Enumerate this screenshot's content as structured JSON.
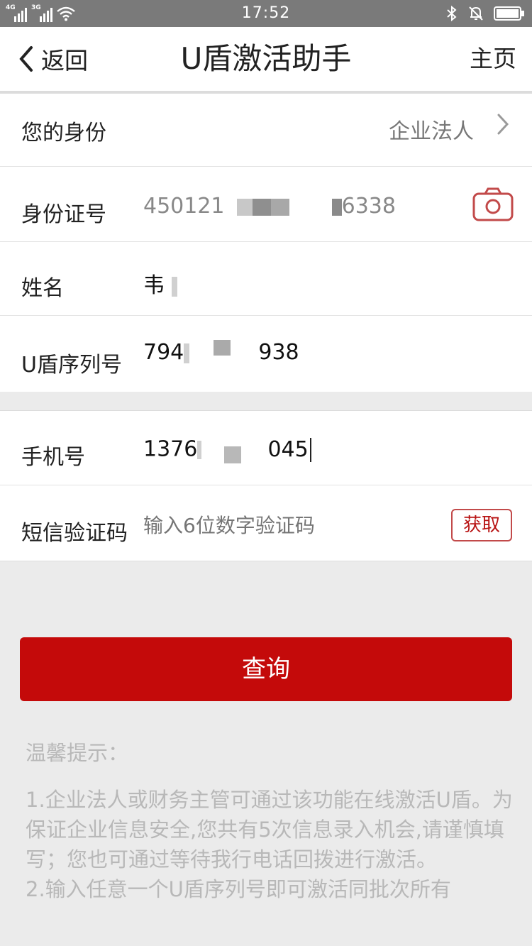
{
  "status_bar": {
    "time": "17:52",
    "signal1_label": "4G",
    "signal2_label": "3G"
  },
  "nav": {
    "back_label": "返回",
    "title": "U盾激活助手",
    "home_label": "主页"
  },
  "form": {
    "identity": {
      "label": "您的身份",
      "value": "企业法人"
    },
    "id_number": {
      "label": "身份证号",
      "prefix": "450121",
      "suffix": "6338"
    },
    "name": {
      "label": "姓名",
      "value": "韦"
    },
    "serial": {
      "label": "U盾序列号",
      "prefix": "794",
      "suffix": "938"
    },
    "phone": {
      "label": "手机号",
      "prefix": "1376",
      "suffix": "045"
    },
    "sms": {
      "label": "短信验证码",
      "placeholder": "输入6位数字验证码",
      "fetch_label": "获取"
    }
  },
  "query_button_label": "查询",
  "tips": {
    "title": "温馨提示：",
    "items": [
      "1.企业法人或财务主管可通过该功能在线激活U盾。为保证企业信息安全,您共有5次信息录入机会,请谨慎填写；您也可通过等待我行电话回拨进行激活。",
      "2.输入任意一个U盾序列号即可激活同批次所有"
    ]
  },
  "colors": {
    "primary_red": "#c40a0a",
    "status_bar": "#7a7a7a",
    "background": "#ebebeb"
  },
  "icons": {
    "back": "chevron-left-icon",
    "identity_arrow": "chevron-right-icon",
    "camera": "camera-icon",
    "bluetooth": "bluetooth-icon",
    "bell_muted": "bell-off-icon",
    "battery": "battery-icon",
    "wifi": "wifi-icon"
  }
}
